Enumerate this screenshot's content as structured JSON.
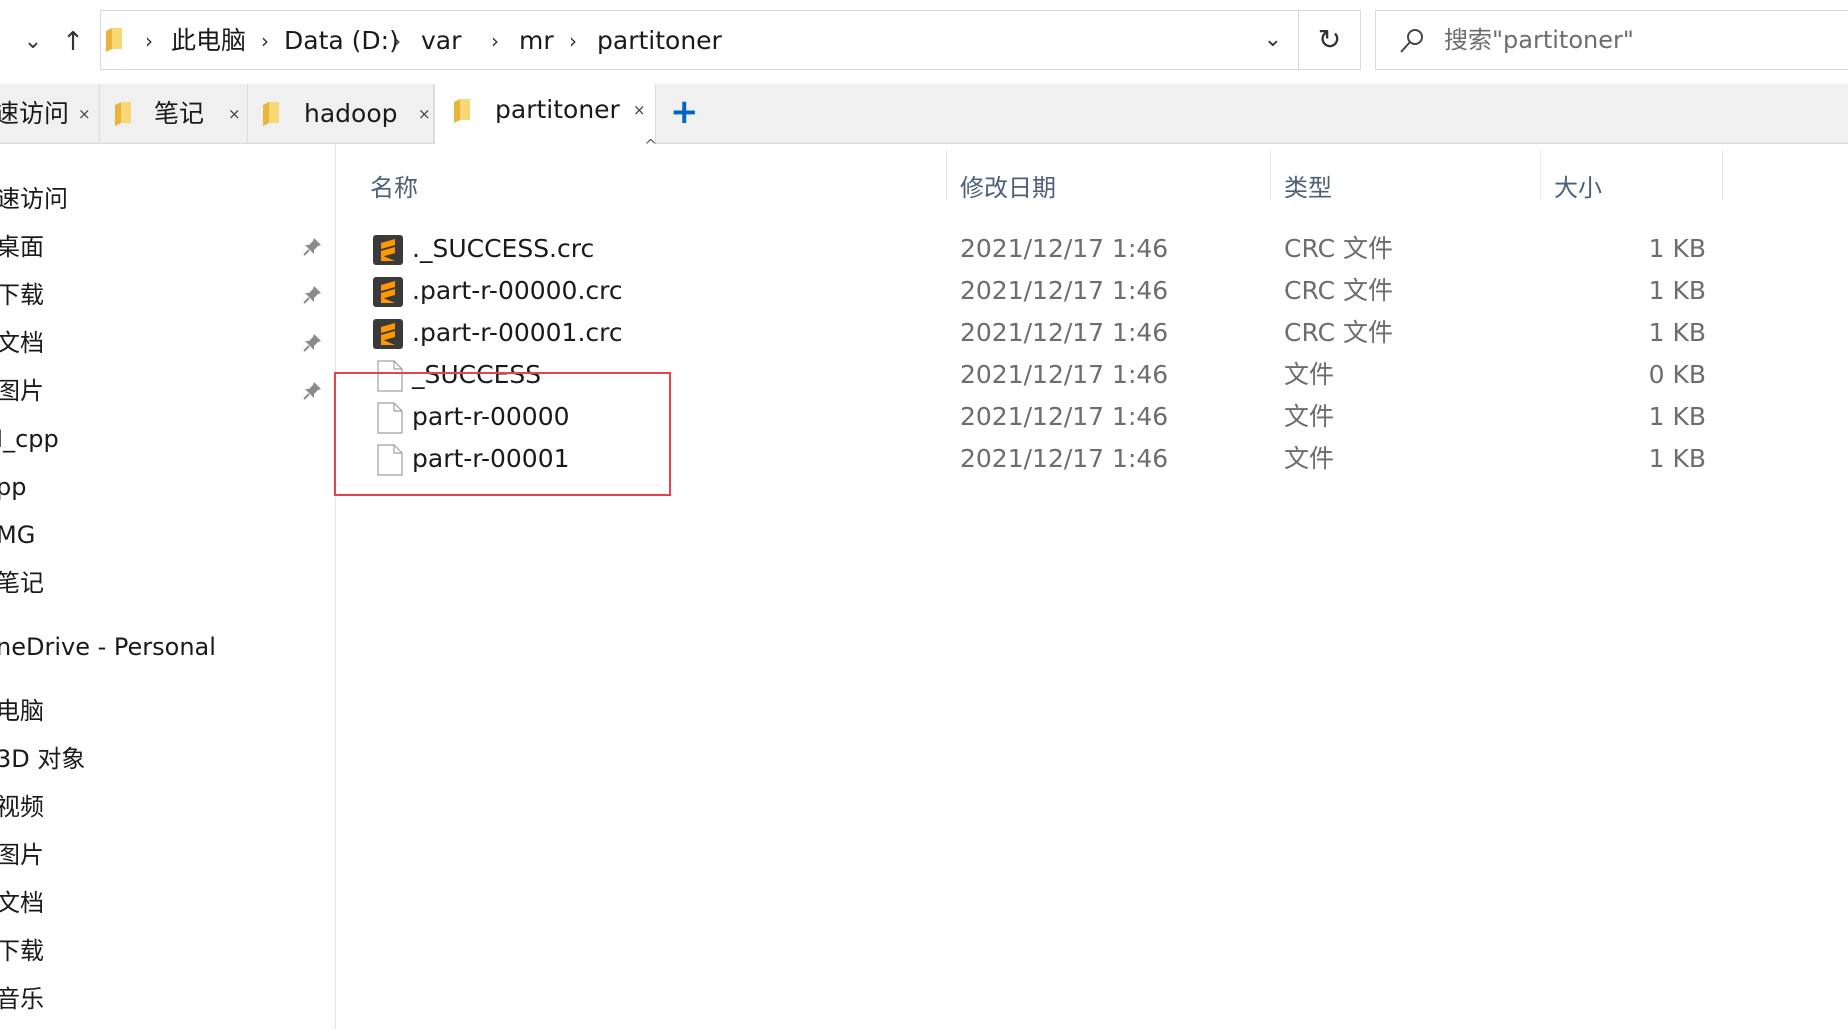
{
  "navigation": {
    "recent_icon": "chevron-down-icon",
    "up_icon": "arrow-up-icon",
    "breadcrumbs": [
      "此电脑",
      "Data (D:)",
      "var",
      "mr",
      "partitoner"
    ],
    "refresh_icon": "refresh-icon",
    "search_placeholder": "搜索\"partitoner\""
  },
  "tabs": [
    {
      "label": "速访问",
      "active": false
    },
    {
      "label": "笔记",
      "active": false
    },
    {
      "label": "hadoop",
      "active": false
    },
    {
      "label": "partitoner",
      "active": true
    }
  ],
  "tab_close_glyph": "×",
  "new_tab_glyph": "+",
  "sidebar": {
    "items": [
      {
        "label": "速访问",
        "pinned": false
      },
      {
        "label": "桌面",
        "pinned": true
      },
      {
        "label": "下载",
        "pinned": true
      },
      {
        "label": "文档",
        "pinned": true
      },
      {
        "label": "图片",
        "pinned": true
      },
      {
        "label": "I_cpp",
        "pinned": false
      },
      {
        "label": "pp",
        "pinned": false
      },
      {
        "label": "MG",
        "pinned": false
      },
      {
        "label": "笔记",
        "pinned": false
      },
      {
        "label": "neDrive - Personal",
        "pinned": false
      },
      {
        "label": "电脑",
        "pinned": false
      },
      {
        "label": "3D 对象",
        "pinned": false
      },
      {
        "label": "视频",
        "pinned": false
      },
      {
        "label": "图片",
        "pinned": false
      },
      {
        "label": "文档",
        "pinned": false
      },
      {
        "label": "下载",
        "pinned": false
      },
      {
        "label": "音乐",
        "pinned": false
      }
    ]
  },
  "file_list": {
    "columns": {
      "name": "名称",
      "modified": "修改日期",
      "type": "类型",
      "size": "大小"
    },
    "sort_indicator": "^",
    "rows": [
      {
        "name": "._SUCCESS.crc",
        "modified": "2021/12/17 1:46",
        "type": "CRC 文件",
        "size": "1 KB",
        "icon": "sublime-text-icon"
      },
      {
        "name": ".part-r-00000.crc",
        "modified": "2021/12/17 1:46",
        "type": "CRC 文件",
        "size": "1 KB",
        "icon": "sublime-text-icon"
      },
      {
        "name": ".part-r-00001.crc",
        "modified": "2021/12/17 1:46",
        "type": "CRC 文件",
        "size": "1 KB",
        "icon": "sublime-text-icon"
      },
      {
        "name": "_SUCCESS",
        "modified": "2021/12/17 1:46",
        "type": "文件",
        "size": "0 KB",
        "icon": "blank-file-icon"
      },
      {
        "name": "part-r-00000",
        "modified": "2021/12/17 1:46",
        "type": "文件",
        "size": "1 KB",
        "icon": "blank-file-icon"
      },
      {
        "name": "part-r-00001",
        "modified": "2021/12/17 1:46",
        "type": "文件",
        "size": "1 KB",
        "icon": "blank-file-icon"
      }
    ]
  },
  "colors": {
    "highlight_box": "#e8424e",
    "accent": "#0067c0",
    "folder": "#f5c342",
    "sublime": "#ff9800"
  }
}
